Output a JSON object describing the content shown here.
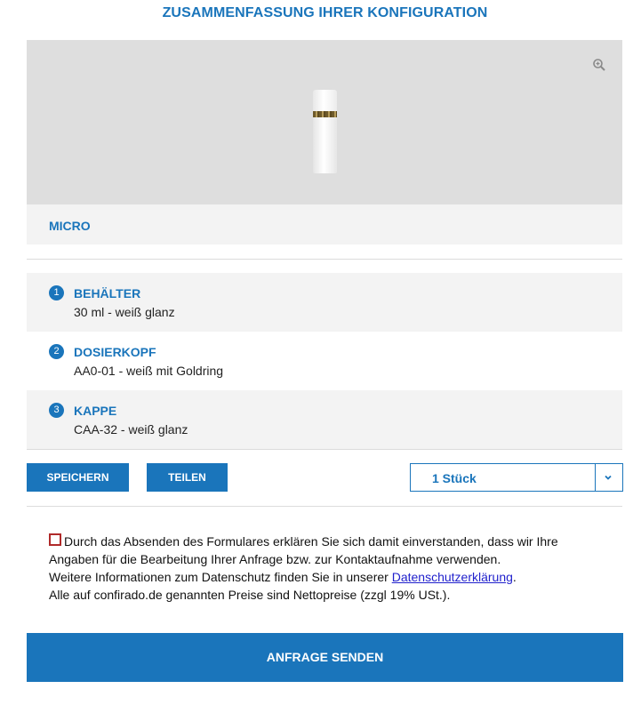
{
  "page_title": "ZUSAMMENFASSUNG IHRER KONFIGURATION",
  "preview": {
    "zoom_icon": "zoom-in-icon",
    "image": "bottle-product-image"
  },
  "product": {
    "name": "MICRO"
  },
  "steps": [
    {
      "number": "1",
      "label": "BEHÄLTER",
      "value": "30 ml - weiß glanz"
    },
    {
      "number": "2",
      "label": "DOSIERKOPF",
      "value": "AA0-01 - weiß mit Goldring"
    },
    {
      "number": "3",
      "label": "KAPPE",
      "value": "CAA-32 - weiß glanz"
    }
  ],
  "actions": {
    "save_label": "SPEICHERN",
    "share_label": "TEILEN"
  },
  "quantity": {
    "selected": "1 Stück",
    "chevron_icon": "chevron-down-icon"
  },
  "consent": {
    "line1": "Durch das Absenden des Formulares erklären Sie sich damit einverstanden, dass wir Ihre",
    "line2": "Angaben für die Bearbeitung Ihrer Anfrage bzw. zur Kontaktaufnahme verwenden.",
    "line3_prefix": "Weitere Informationen zum Datenschutz finden Sie in unserer ",
    "link_text": "Datenschutzerklärung",
    "line3_suffix": ".",
    "line4": "Alle auf confirado.de genannten Preise sind Nettopreise (zzgl 19% USt.)."
  },
  "submit_label": "ANFRAGE SENDEN",
  "colors": {
    "accent": "#1a75bb",
    "panel": "#f3f3f3",
    "preview_bg": "#dedede",
    "checkbox_border": "#b02a2a"
  }
}
